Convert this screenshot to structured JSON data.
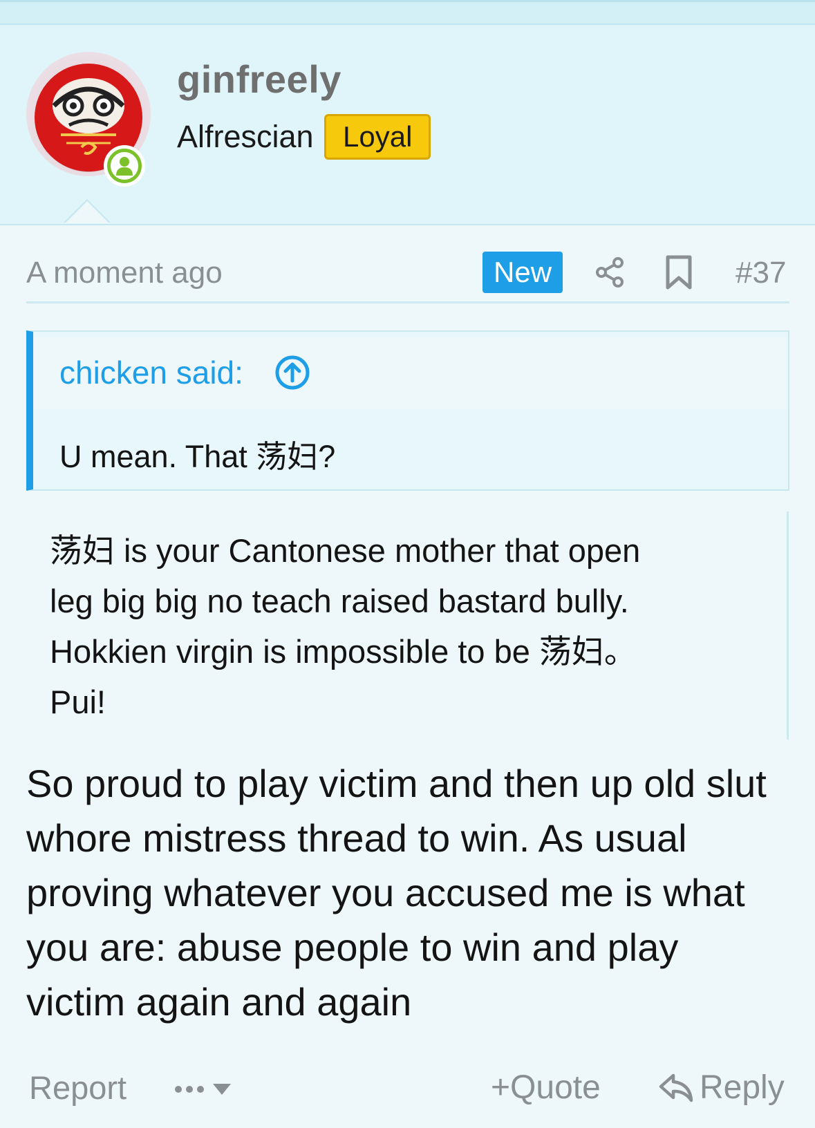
{
  "post": {
    "author": {
      "username": "ginfreely",
      "title": "Alfrescian",
      "badge": "Loyal",
      "status": "online"
    },
    "meta": {
      "time": "A moment ago",
      "new_label": "New",
      "number": "#37",
      "icons": [
        "share-icon",
        "bookmark-icon"
      ]
    },
    "quote": {
      "author": "chicken said:",
      "body": "U mean. That 荡妇?"
    },
    "inner_quote": {
      "lines": [
        "荡妇 is your Cantonese mother that open",
        "leg big big no teach raised bastard bully.",
        "Hokkien virgin is impossible to be 荡妇。",
        "Pui!"
      ]
    },
    "body_lines": [
      "So proud to play victim and then up old slut",
      "whore mistress thread to win. As usual",
      "proving whatever you accused me is what",
      "you are: abuse people to win and play",
      "victim again and again"
    ],
    "actions": {
      "report": "Report",
      "quote": "Quote",
      "quote_prefix": "+",
      "reply": "Reply"
    }
  },
  "colors": {
    "accent": "#1d9ee6",
    "badge_loyal": "#f7c90d",
    "online": "#7cc02a",
    "header_bg": "#dff5f9",
    "page_bg": "#eef8fb"
  }
}
